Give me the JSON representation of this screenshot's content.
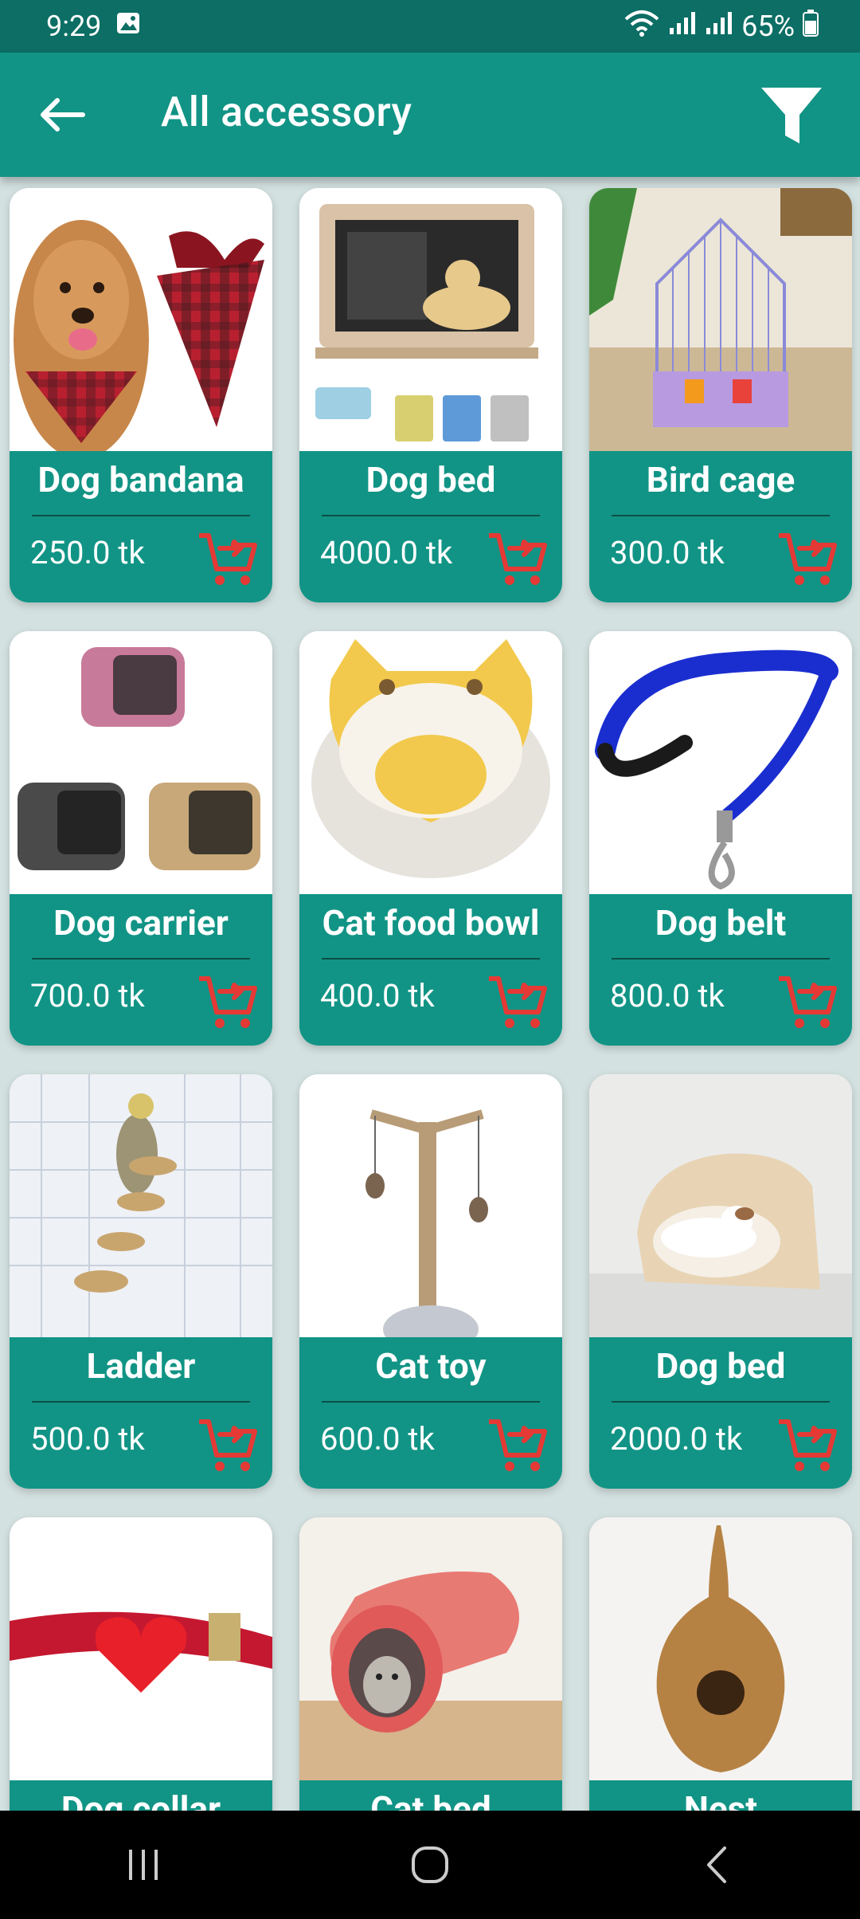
{
  "status": {
    "time": "9:29",
    "battery": "65%"
  },
  "appbar": {
    "title": "All accessory"
  },
  "colors": {
    "primary": "#119485",
    "statusbar": "#0c6e64",
    "cart": "#e53935",
    "background": "#d3e1e0"
  },
  "products": [
    {
      "name": "Dog bandana",
      "price": "250.0 tk"
    },
    {
      "name": "Dog bed",
      "price": "4000.0 tk"
    },
    {
      "name": "Bird cage",
      "price": "300.0 tk"
    },
    {
      "name": "Dog carrier",
      "price": "700.0 tk"
    },
    {
      "name": "Cat food bowl",
      "price": "400.0 tk"
    },
    {
      "name": "Dog belt",
      "price": "800.0 tk"
    },
    {
      "name": "Ladder",
      "price": "500.0 tk"
    },
    {
      "name": "Cat toy",
      "price": "600.0 tk"
    },
    {
      "name": "Dog bed",
      "price": "2000.0 tk"
    },
    {
      "name": "Dog collar",
      "price": ""
    },
    {
      "name": "Cat bed",
      "price": ""
    },
    {
      "name": "Nest",
      "price": ""
    }
  ],
  "icons": {
    "back": "arrow-left-icon",
    "filter": "filter-icon",
    "cart": "add-to-cart-icon",
    "nav": [
      "recents-icon",
      "home-icon",
      "back-nav-icon"
    ]
  }
}
